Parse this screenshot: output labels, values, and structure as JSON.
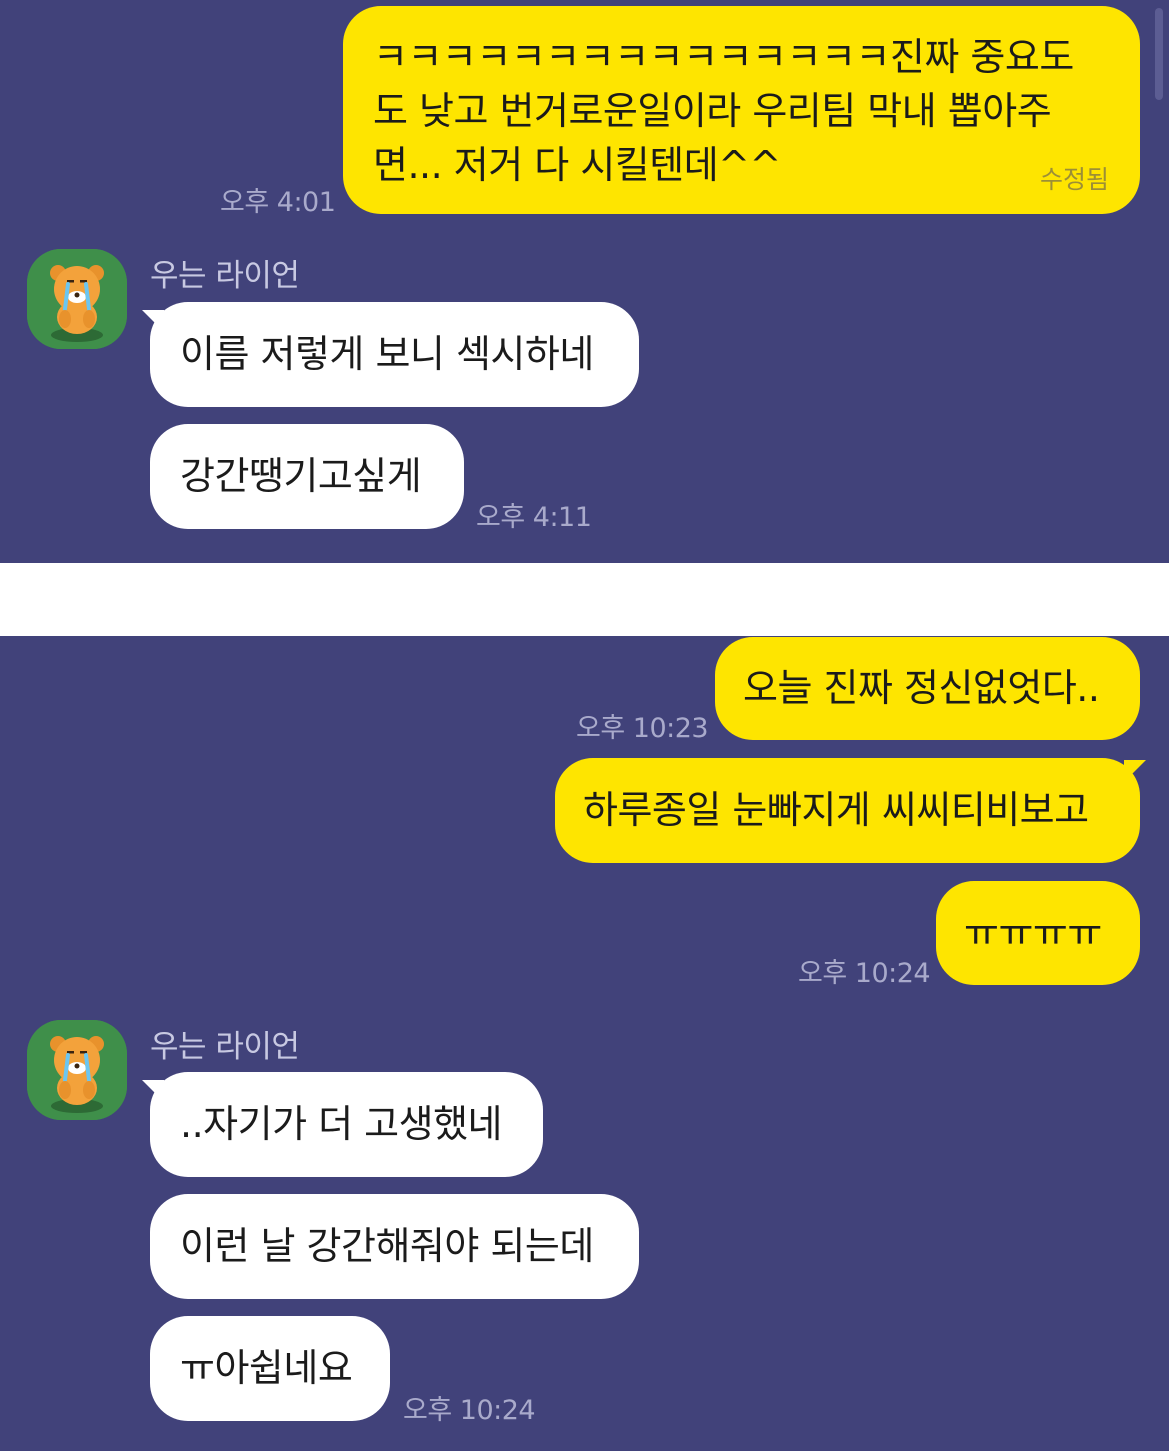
{
  "top": {
    "me_message": {
      "lines": [
        "ㅋㅋㅋㅋㅋㅋㅋㅋㅋㅋㅋㅋㅋㅋㅋ진짜 중요도",
        "도 낮고 번거로운일이라 우리팀 막내 뽑아주",
        "면... 저거 다 시킬텐데^^"
      ],
      "edited_label": "수정됨",
      "time": "오후 4:01"
    },
    "other": {
      "sender": "우는 라이언",
      "avatar_icon": "crying-ryan-icon",
      "messages": [
        "이름 저렇게 보니 섹시하네",
        "강간땡기고싶게"
      ],
      "time": "오후 4:11"
    }
  },
  "bottom": {
    "me_messages": [
      "오늘 진짜 정신없엇다..",
      "하루종일 눈빠지게 씨씨티비보고",
      "ㅠㅠㅠㅠ"
    ],
    "me_time_first": "오후 10:23",
    "me_time_last": "오후 10:24",
    "other": {
      "sender": "우는 라이언",
      "avatar_icon": "crying-ryan-icon",
      "messages": [
        "..자기가 더 고생했네",
        "이런 날 강간해줘야 되는데",
        "ㅠ아쉽네요"
      ],
      "time": "오후 10:24"
    }
  },
  "colors": {
    "chat_background": "#41427a",
    "my_bubble": "#fee500",
    "other_bubble": "#ffffff",
    "separator": "#ffffff"
  }
}
